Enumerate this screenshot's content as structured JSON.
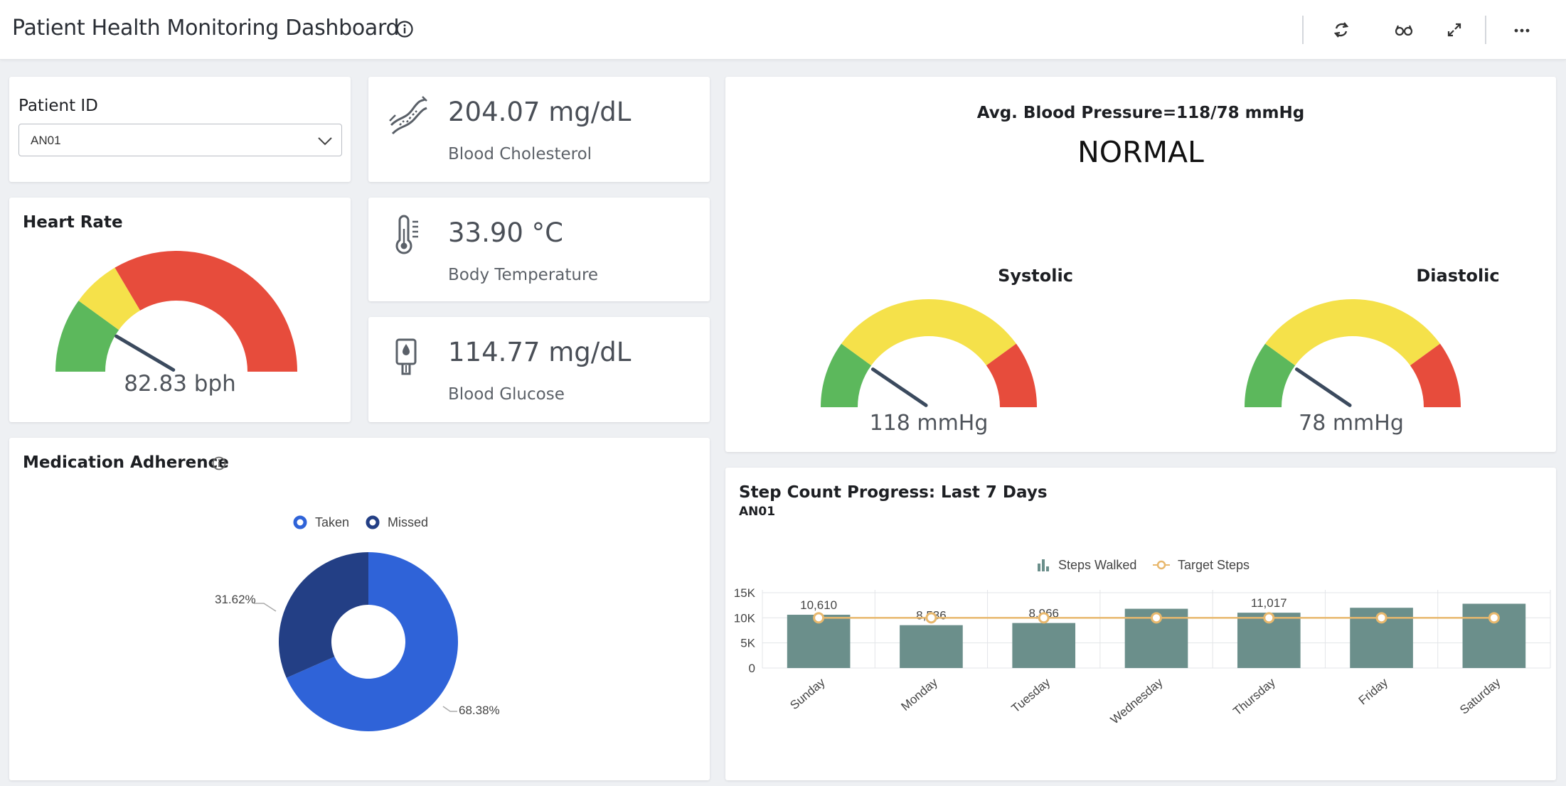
{
  "header": {
    "title": "Patient Health Monitoring Dashboard",
    "info_icon": "info-circle-icon",
    "tools": [
      "refresh-icon",
      "glasses-icon",
      "expand-icon",
      "more-icon"
    ]
  },
  "patient": {
    "label": "Patient ID",
    "value": "AN01"
  },
  "kpis": [
    {
      "icon": "artery-icon",
      "value": "204.07 mg/dL",
      "label": "Blood Cholesterol"
    },
    {
      "icon": "thermometer-icon",
      "value": "33.90 °C",
      "label": "Body Temperature"
    },
    {
      "icon": "glucose-meter-icon",
      "value": "114.77 mg/dL",
      "label": "Blood Glucose"
    }
  ],
  "heart_rate": {
    "title": "Heart Rate",
    "value_text": "82.83 bph",
    "needle_fraction": 0.17
  },
  "blood_pressure": {
    "header": "Avg. Blood Pressure=118/78  mmHg",
    "status": "NORMAL",
    "systolic": {
      "title": "Systolic",
      "value_text": "118 mmHg",
      "needle_fraction": 0.19
    },
    "diastolic": {
      "title": "Diastolic",
      "value_text": "78 mmHg",
      "needle_fraction": 0.19
    }
  },
  "gauge_colors": {
    "green": "#5cb85c",
    "yellow": "#f5e14a",
    "red": "#e74c3c",
    "needle": "#3b4a5e"
  },
  "medication": {
    "title": "Medication Adherence",
    "legend": [
      {
        "label": "Taken",
        "color": "#2f63d8"
      },
      {
        "label": "Missed",
        "color": "#233f85"
      }
    ],
    "chart_data": {
      "type": "pie",
      "donut": true,
      "slices": [
        {
          "label": "Taken",
          "value": 68.38,
          "text": "68.38%",
          "color": "#2f63d8"
        },
        {
          "label": "Missed",
          "value": 31.62,
          "text": "31.62%",
          "color": "#233f85"
        }
      ]
    }
  },
  "steps": {
    "title": "Step Count Progress: Last 7 Days",
    "subtitle": "AN01",
    "legend_bar": "Steps Walked",
    "legend_line": "Target Steps",
    "bar_color": "#6b8f8b",
    "line_color": "#e8b86d",
    "chart_data": {
      "type": "bar",
      "categories": [
        "Sunday",
        "Monday",
        "Tuesday",
        "Wednesday",
        "Thursday",
        "Friday",
        "Saturday"
      ],
      "series": [
        {
          "name": "Steps Walked",
          "type": "bar",
          "values": [
            10610,
            8536,
            8966,
            11800,
            11017,
            12000,
            12800
          ]
        },
        {
          "name": "Target Steps",
          "type": "line",
          "values": [
            10000,
            10000,
            10000,
            10000,
            10000,
            10000,
            10000
          ]
        }
      ],
      "data_labels": [
        "10,610",
        "8,536",
        "8,966",
        "",
        "11,017",
        "",
        ""
      ],
      "yticks": [
        "0",
        "5K",
        "10K",
        "15K"
      ],
      "ylim": [
        0,
        15000
      ]
    }
  }
}
